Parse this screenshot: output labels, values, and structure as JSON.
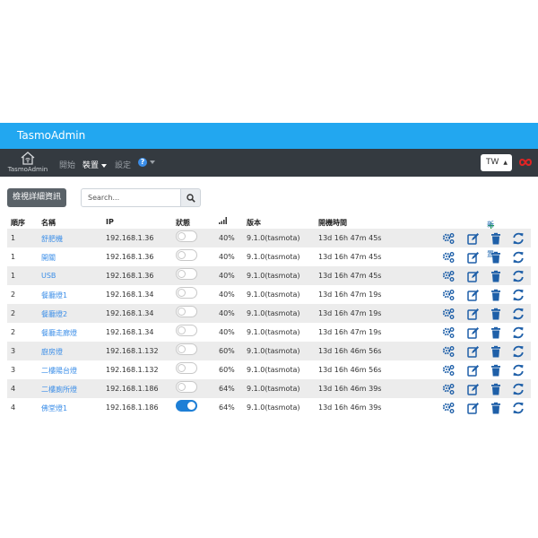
{
  "header": {
    "title": "TasmoAdmin"
  },
  "nav": {
    "logo_text": "TasmoAdmin",
    "start": "開始",
    "devices": "裝置",
    "settings": "設定",
    "help": "?",
    "lang": "TW"
  },
  "toolbar": {
    "details_button": "檢視詳細資訊",
    "search_placeholder": "Search..."
  },
  "table": {
    "headers": {
      "order": "順序",
      "name": "名稱",
      "ip": "IP",
      "status": "狀態",
      "version": "版本",
      "uptime": "開機時間"
    },
    "add_device": "新增裝置",
    "rows": [
      {
        "order": "1",
        "name": "舒肥機",
        "ip": "192.168.1.36",
        "on": false,
        "signal": "40%",
        "version": "9.1.0(tasmota)",
        "uptime": "13d 16h 47m 45s"
      },
      {
        "order": "1",
        "name": "開關",
        "ip": "192.168.1.36",
        "on": false,
        "signal": "40%",
        "version": "9.1.0(tasmota)",
        "uptime": "13d 16h 47m 45s"
      },
      {
        "order": "1",
        "name": "USB",
        "ip": "192.168.1.36",
        "on": false,
        "signal": "40%",
        "version": "9.1.0(tasmota)",
        "uptime": "13d 16h 47m 45s"
      },
      {
        "order": "2",
        "name": "餐廳燈1",
        "ip": "192.168.1.34",
        "on": false,
        "signal": "40%",
        "version": "9.1.0(tasmota)",
        "uptime": "13d 16h 47m 19s"
      },
      {
        "order": "2",
        "name": "餐廳燈2",
        "ip": "192.168.1.34",
        "on": false,
        "signal": "40%",
        "version": "9.1.0(tasmota)",
        "uptime": "13d 16h 47m 19s"
      },
      {
        "order": "2",
        "name": "餐廳走廊燈",
        "ip": "192.168.1.34",
        "on": false,
        "signal": "40%",
        "version": "9.1.0(tasmota)",
        "uptime": "13d 16h 47m 19s"
      },
      {
        "order": "3",
        "name": "廚房燈",
        "ip": "192.168.1.132",
        "on": false,
        "signal": "60%",
        "version": "9.1.0(tasmota)",
        "uptime": "13d 16h 46m 56s"
      },
      {
        "order": "3",
        "name": "二樓陽台燈",
        "ip": "192.168.1.132",
        "on": false,
        "signal": "60%",
        "version": "9.1.0(tasmota)",
        "uptime": "13d 16h 46m 56s"
      },
      {
        "order": "4",
        "name": "二樓廁所燈",
        "ip": "192.168.1.186",
        "on": false,
        "signal": "64%",
        "version": "9.1.0(tasmota)",
        "uptime": "13d 16h 46m 39s"
      },
      {
        "order": "4",
        "name": "佛堂燈1",
        "ip": "192.168.1.186",
        "on": true,
        "signal": "64%",
        "version": "9.1.0(tasmota)",
        "uptime": "13d 16h 46m 39s"
      }
    ]
  },
  "colors": {
    "accent": "#22a7f0",
    "navbar": "#343a40",
    "link": "#3b8ee8",
    "icon": "#1e5fa8",
    "add": "#1a9e46"
  },
  "icons": {
    "actions": [
      "gears-icon",
      "edit-icon",
      "trash-icon",
      "refresh-icon"
    ],
    "signal": "signal-icon",
    "search": "search-icon",
    "home": "home-wifi-icon",
    "flag": "infinity-icon"
  }
}
